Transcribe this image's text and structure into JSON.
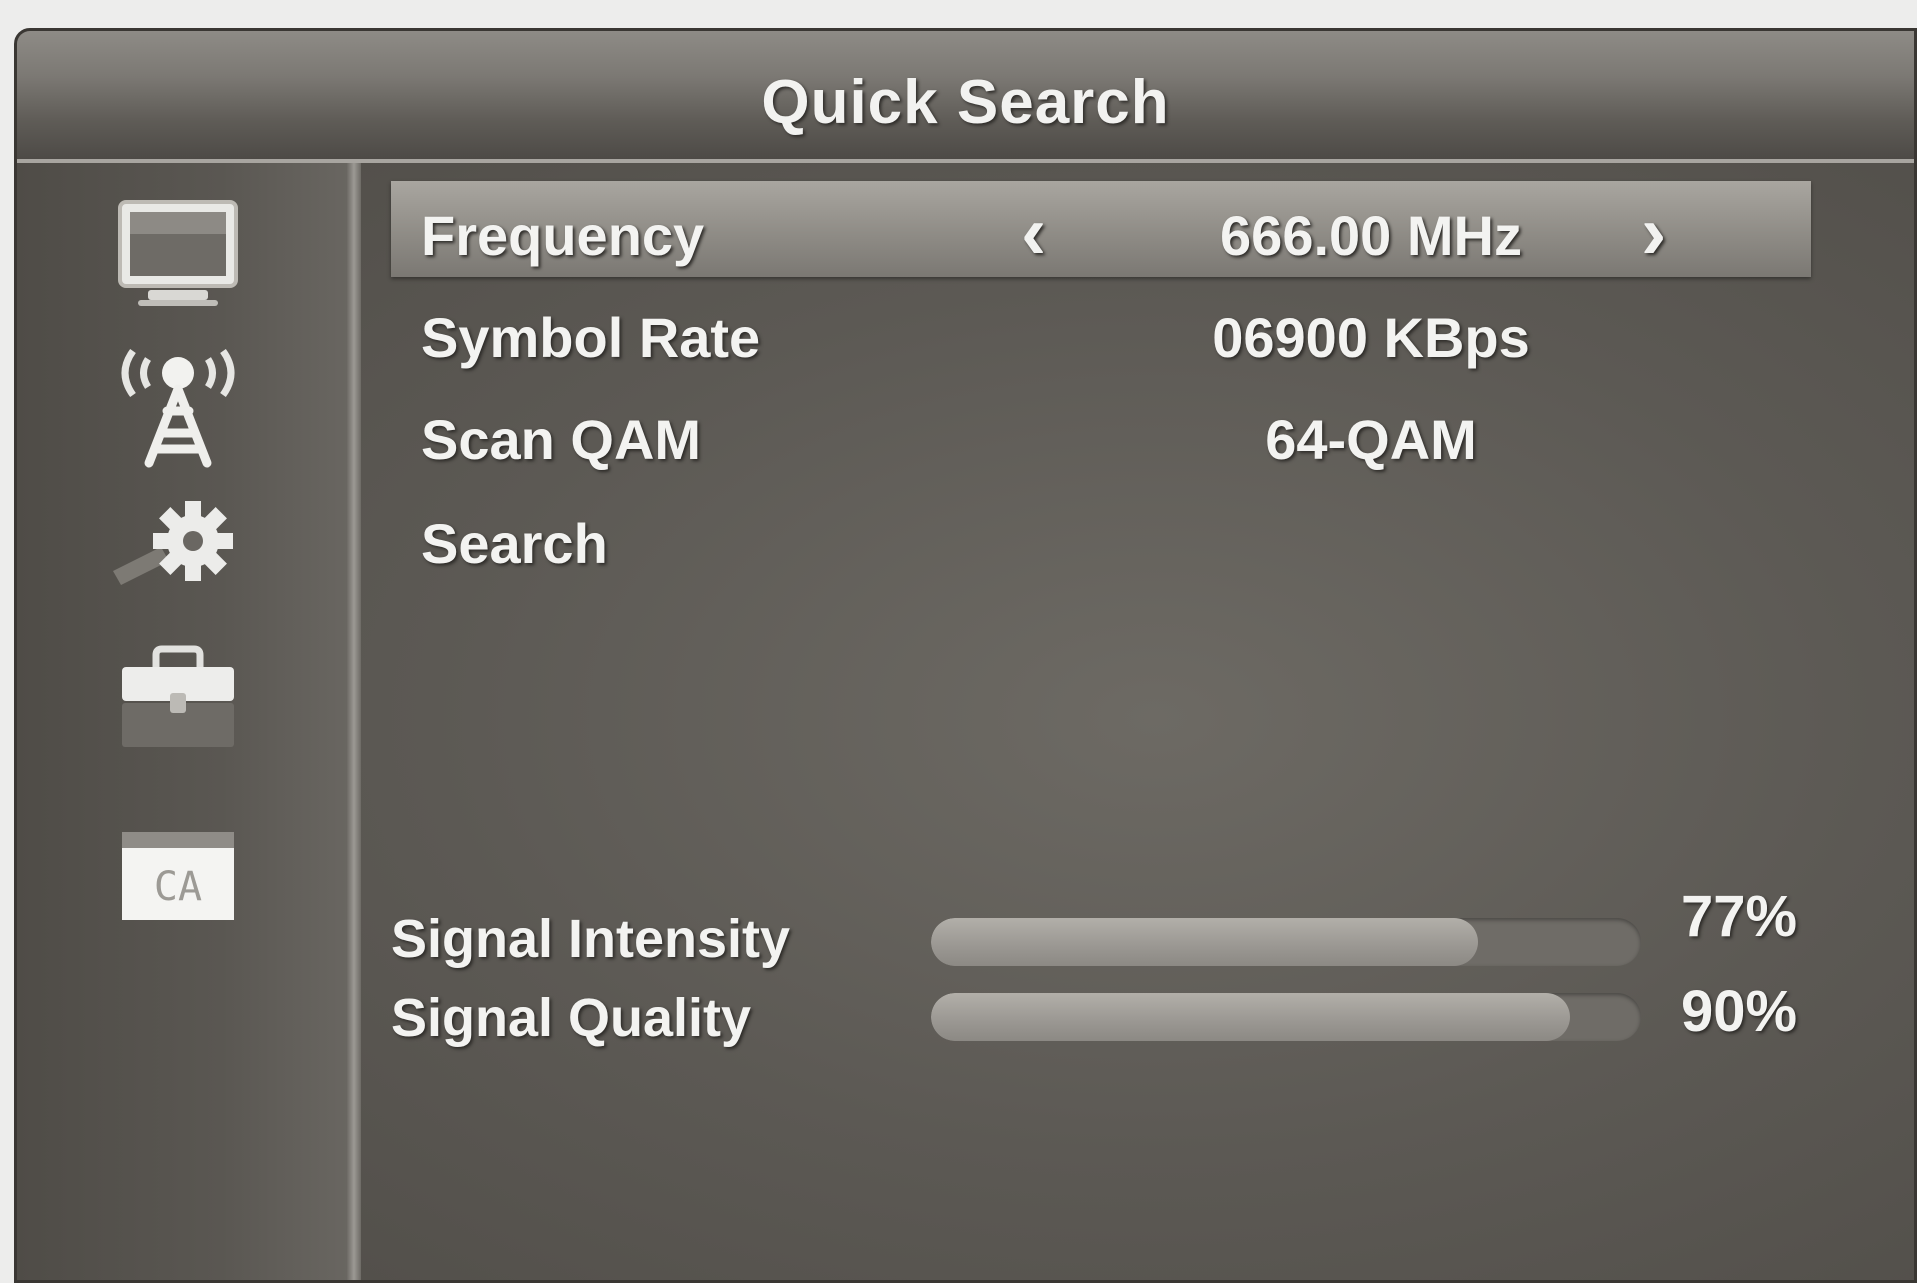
{
  "header": {
    "title": "Quick Search"
  },
  "sidebar": {
    "icons": [
      {
        "name": "tv-icon"
      },
      {
        "name": "antenna-icon"
      },
      {
        "name": "settings-icon"
      },
      {
        "name": "toolbox-icon"
      },
      {
        "name": "ca-icon",
        "text": "CA"
      }
    ]
  },
  "menu": {
    "items": [
      {
        "label": "Frequency",
        "value": "666.00 MHz",
        "selected": true,
        "left_arrow": "‹",
        "right_arrow": "›"
      },
      {
        "label": "Symbol Rate",
        "value": "06900 KBps"
      },
      {
        "label": "Scan QAM",
        "value": "64-QAM"
      },
      {
        "label": "Search",
        "value": ""
      }
    ]
  },
  "signal": {
    "intensity": {
      "label": "Signal Intensity",
      "value": "77%",
      "level": 0.77
    },
    "quality": {
      "label": "Signal Quality",
      "value": "90%",
      "level": 0.9
    }
  },
  "colors": {
    "background": "#5c5954",
    "highlight": "#9a9791",
    "text": "#f3f3f1"
  }
}
